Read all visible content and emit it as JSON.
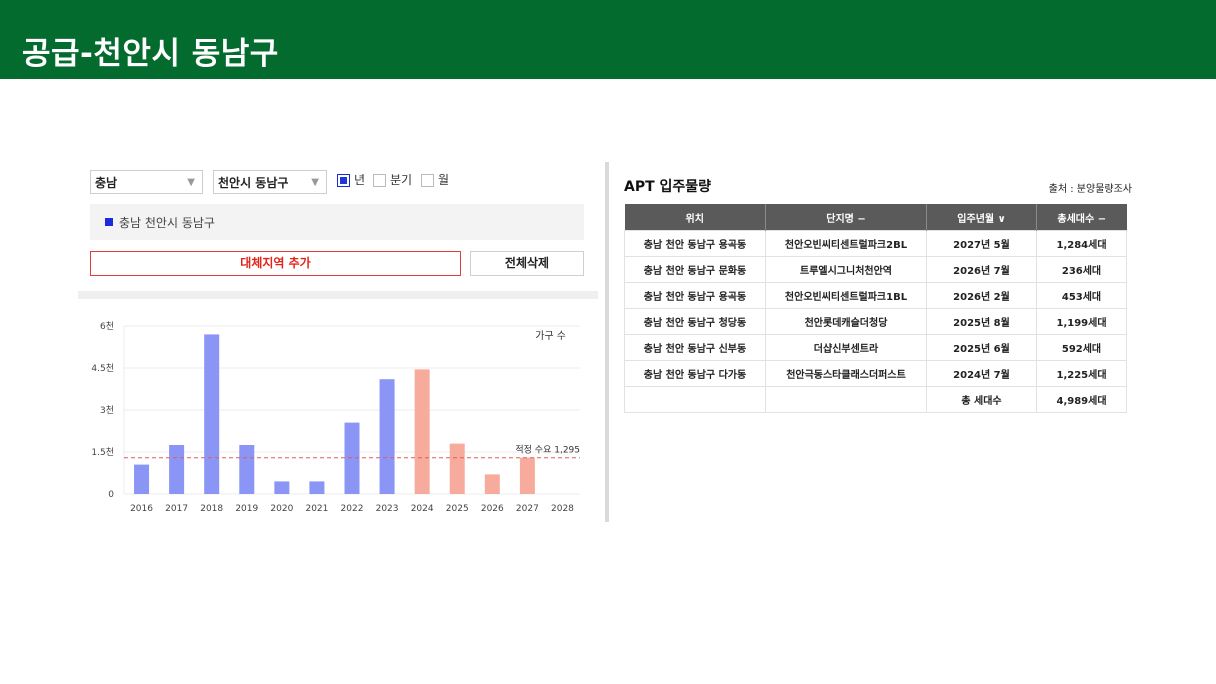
{
  "header": {
    "title": "공급-천안시 동남구"
  },
  "filters": {
    "province": "충남",
    "district": "천안시 동남구",
    "period_options": [
      {
        "label": "년",
        "checked": true
      },
      {
        "label": "분기",
        "checked": false
      },
      {
        "label": "월",
        "checked": false
      }
    ]
  },
  "region_tag": "충남 천안시 동남구",
  "buttons": {
    "add_region": "대체지역 추가",
    "delete_all": "전체삭제"
  },
  "chart_data": {
    "type": "bar",
    "categories": [
      "2016",
      "2017",
      "2018",
      "2019",
      "2020",
      "2021",
      "2022",
      "2023",
      "2024",
      "2025",
      "2026",
      "2027",
      "2028"
    ],
    "values": [
      1050,
      1750,
      5700,
      1750,
      450,
      450,
      2550,
      4100,
      4450,
      1800,
      700,
      1300,
      0
    ],
    "past_color": "#8b95f5",
    "future_color": "#f7ab9c",
    "future_from": "2024",
    "ylim": [
      0,
      6000
    ],
    "yticks": [
      {
        "value": 0,
        "label": "0"
      },
      {
        "value": 1500,
        "label": "1.5천"
      },
      {
        "value": 3000,
        "label": "3천"
      },
      {
        "value": 4500,
        "label": "4.5천"
      },
      {
        "value": 6000,
        "label": "6천"
      }
    ],
    "legend": "가구 수",
    "reference_line": {
      "value": 1295,
      "label": "적정 수요 1,295",
      "color": "#e85a5a"
    }
  },
  "apt": {
    "title": "APT 입주물량",
    "source": "출처 : 분양물량조사",
    "headers": [
      "위치",
      "단지명 −",
      "입주년월 ∨",
      "총세대수 −"
    ],
    "rows": [
      [
        "충남 천안 동남구 용곡동",
        "천안오빈씨티센트럴파크2BL",
        "2027년 5월",
        "1,284세대"
      ],
      [
        "충남 천안 동남구 문화동",
        "트루엘시그니처천안역",
        "2026년 7월",
        "236세대"
      ],
      [
        "충남 천안 동남구 용곡동",
        "천안오빈씨티센트럴파크1BL",
        "2026년 2월",
        "453세대"
      ],
      [
        "충남 천안 동남구 청당동",
        "천안롯데캐슬더청당",
        "2025년 8월",
        "1,199세대"
      ],
      [
        "충남 천안 동남구 신부동",
        "더샵신부센트라",
        "2025년 6월",
        "592세대"
      ],
      [
        "충남 천안 동남구 다가동",
        "천안극동스타클래스더퍼스트",
        "2024년 7월",
        "1,225세대"
      ]
    ],
    "total": {
      "label": "총 세대수",
      "value": "4,989세대"
    }
  }
}
